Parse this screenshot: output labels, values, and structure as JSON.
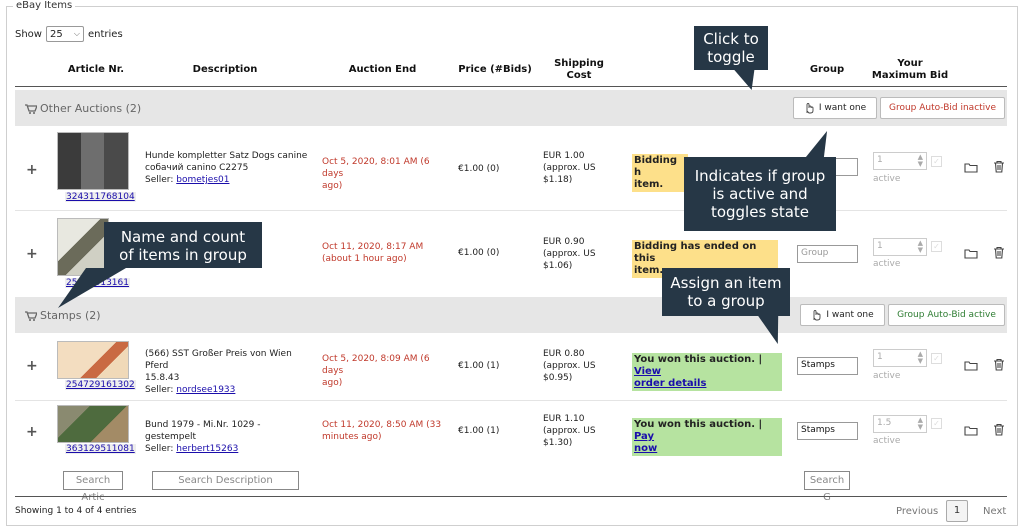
{
  "panel": {
    "legend": "eBay Items"
  },
  "length": {
    "show": "Show",
    "value": "25",
    "entries": "entries"
  },
  "headers": {
    "article": "Article Nr.",
    "description": "Description",
    "auction_end": "Auction End",
    "price": "Price (#Bids)",
    "shipping_1": "Shipping",
    "shipping_2": "Cost",
    "group": "Group",
    "max_bid_1": "Your",
    "max_bid_2": "Maximum Bid"
  },
  "groups": [
    {
      "title": "Other Auctions (2)",
      "want_label": "I want one",
      "autobid_label": "Group Auto-Bid inactive"
    },
    {
      "title": "Stamps (2)",
      "want_label": "I want one",
      "autobid_label": "Group Auto-Bid active"
    }
  ],
  "rows": [
    {
      "article_id": "324311768104",
      "desc_1": "Hunde kompletter Satz Dogs canine",
      "desc_2": "собачий canino C2275",
      "seller_label": "Seller:",
      "seller": "bometjes01",
      "end_1": "Oct 5, 2020, 8:01 AM (6 days",
      "end_2": "ago)",
      "price": "€1.00 (0)",
      "ship_1": "EUR 1.00",
      "ship_2": "(approx. US",
      "ship_3": "$1.18)",
      "status_1": "Bidding h",
      "status_2": "item.",
      "group_value": "",
      "bid": "1",
      "bid_state": "active"
    },
    {
      "article_id": "25473513161",
      "end_1": "Oct 11, 2020, 8:17 AM",
      "end_2": "(about 1 hour ago)",
      "price": "€1.00 (0)",
      "ship_1": "EUR 0.90",
      "ship_2": "(approx. US",
      "ship_3": "$1.06)",
      "status_1": "Bidding has ended on this",
      "status_2": "item.",
      "group_placeholder": "Group",
      "bid": "1",
      "bid_state": "active"
    },
    {
      "article_id": "254729161302",
      "desc_1": "(566) SST Großer Preis von Wien Pferd",
      "desc_2": "15.8.43",
      "seller_label": "Seller:",
      "seller": "nordsee1933",
      "end_1": "Oct 5, 2020, 8:09 AM (6 days",
      "end_2": "ago)",
      "price": "€1.00 (1)",
      "ship_1": "EUR 0.80",
      "ship_2": "(approx. US",
      "ship_3": "$0.95)",
      "status_1": "You won this auction. |",
      "status_link_1": "View",
      "status_link_2": "order details",
      "group_value": "Stamps",
      "bid": "1",
      "bid_state": "active"
    },
    {
      "article_id": "363129511081",
      "desc_1": "Bund 1979 - Mi.Nr. 1029 - gestempelt",
      "seller_label": "Seller:",
      "seller": "herbert15263",
      "end_1": "Oct 11, 2020, 8:50 AM (33",
      "end_2": "minutes ago)",
      "price": "€1.00 (1)",
      "ship_1": "EUR 1.10",
      "ship_2": "(approx. US",
      "ship_3": "$1.30)",
      "status_1": "You won this auction. |",
      "status_link_1": "Pay",
      "status_link_2": "now",
      "group_value": "Stamps",
      "bid": "1.5",
      "bid_state": "active"
    }
  ],
  "search": {
    "article_placeholder": "Search Artic",
    "description_placeholder": "Search Description",
    "group_placeholder": "Search G"
  },
  "footer": {
    "info": "Showing 1 to 4 of 4 entries",
    "previous": "Previous",
    "page": "1",
    "next": "Next"
  },
  "callouts": {
    "toggle_1": "Click to",
    "toggle_2": "toggle",
    "group_state_1": "Indicates if group",
    "group_state_2": "is active  and",
    "group_state_3": "toggles state",
    "name_count_1": "Name and count",
    "name_count_2": "of items in group",
    "assign_1": "Assign an item",
    "assign_2": "to a group"
  },
  "colors": {
    "callout": "#263746",
    "status_pending": "#fde08a",
    "status_won": "#b6e3a0",
    "end_date": "#c0392b",
    "group_row": "#e6e6e6"
  },
  "icons": [
    "shopping-cart-icon",
    "hand-pointer-icon",
    "folder-icon",
    "trash-icon",
    "checkbox-icon",
    "plus-icon"
  ]
}
